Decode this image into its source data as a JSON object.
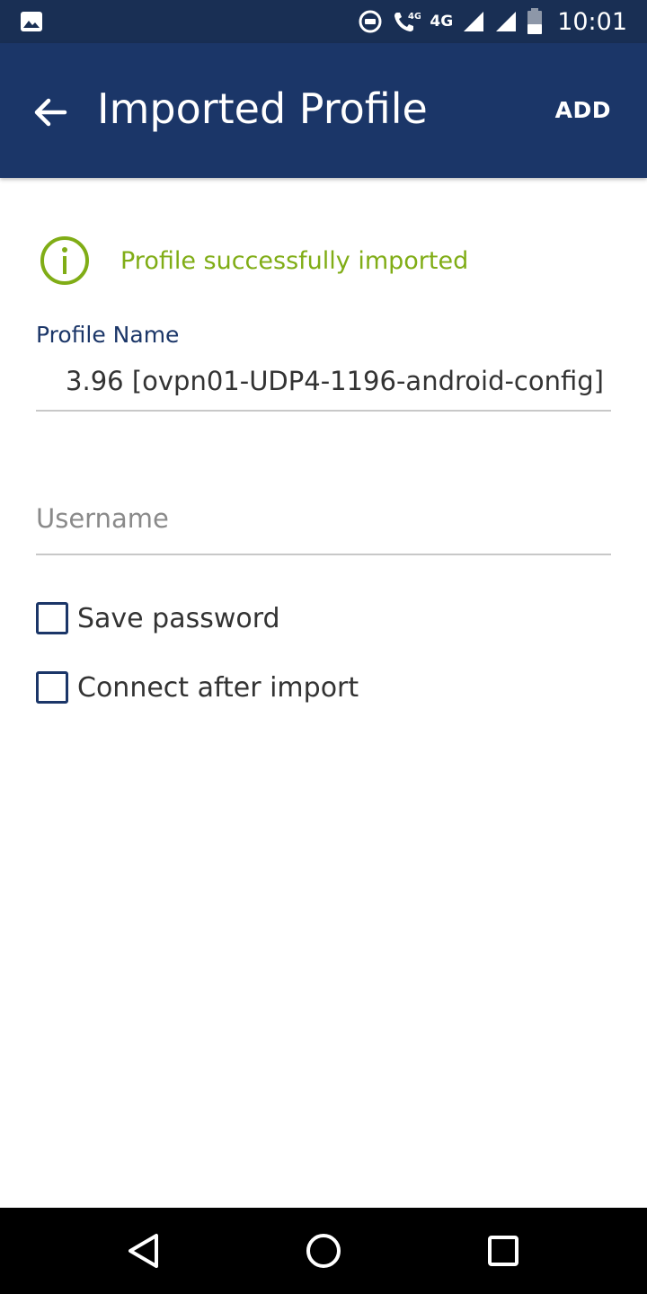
{
  "status_bar": {
    "time": "10:01",
    "network_label_1": "4G",
    "network_label_2": "4G",
    "icons": [
      "image-notification-icon",
      "data-saver-icon",
      "volte-call-icon",
      "signal-icon",
      "battery-icon"
    ]
  },
  "app_bar": {
    "title": "Imported Profile",
    "action_label": "ADD",
    "back_icon": "arrow-left-icon",
    "color": "#1b3668"
  },
  "notice": {
    "icon": "info-icon",
    "message": "Profile successfully imported",
    "color": "#80ad16"
  },
  "form": {
    "profile_name_label": "Profile Name",
    "profile_name_value": "3.96 [ovpn01-UDP4-1196-android-config]",
    "username_placeholder": "Username",
    "username_value": "",
    "save_password_label": "Save password",
    "save_password_checked": false,
    "connect_after_import_label": "Connect after import",
    "connect_after_import_checked": false
  },
  "nav_bar": {
    "buttons": [
      "back-triangle-icon",
      "home-circle-icon",
      "recents-square-icon"
    ]
  }
}
